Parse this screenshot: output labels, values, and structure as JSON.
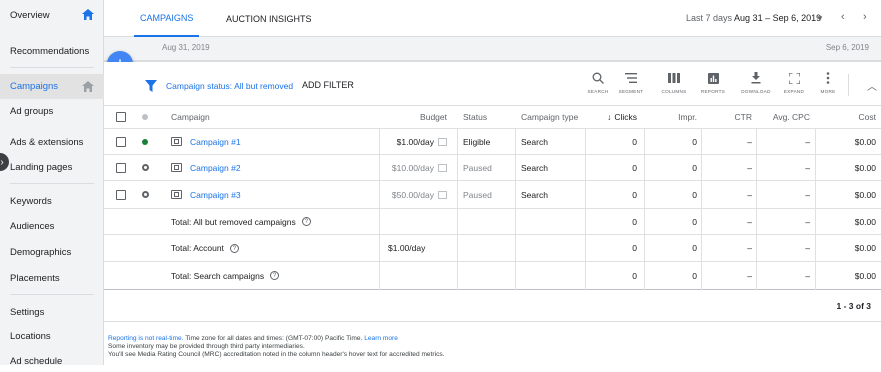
{
  "sidebar": {
    "items": [
      {
        "label": "Overview"
      },
      {
        "label": "Recommendations"
      },
      {
        "label": "Campaigns"
      },
      {
        "label": "Ad groups"
      },
      {
        "label": "Ads & extensions"
      },
      {
        "label": "Landing pages"
      },
      {
        "label": "Keywords"
      },
      {
        "label": "Audiences"
      },
      {
        "label": "Demographics"
      },
      {
        "label": "Placements"
      },
      {
        "label": "Settings"
      },
      {
        "label": "Locations"
      },
      {
        "label": "Ad schedule"
      }
    ]
  },
  "tabs": [
    {
      "label": "CAMPAIGNS"
    },
    {
      "label": "AUCTION INSIGHTS"
    }
  ],
  "date_range": {
    "prefix": "Last 7 days",
    "value": "Aug 31 – Sep 6, 2019"
  },
  "timeline": {
    "start": "Aug 31, 2019",
    "end": "Sep 6, 2019"
  },
  "filter": {
    "label": "Campaign status:",
    "value": "All but removed",
    "add": "ADD FILTER"
  },
  "toolbar": {
    "search": "SEARCH",
    "segment": "SEGMENT",
    "columns": "COLUMNS",
    "reports": "REPORTS",
    "download": "DOWNLOAD",
    "expand": "EXPAND",
    "more": "MORE"
  },
  "table": {
    "headers": {
      "campaign": "Campaign",
      "budget": "Budget",
      "status": "Status",
      "type": "Campaign type",
      "clicks": "Clicks",
      "impr": "Impr.",
      "ctr": "CTR",
      "cpc": "Avg. CPC",
      "cost": "Cost"
    },
    "rows": [
      {
        "name": "Campaign #1",
        "budget": "$1.00/day",
        "status": "Eligible",
        "type": "Search",
        "clicks": "0",
        "impr": "0",
        "ctr": "–",
        "cpc": "–",
        "cost": "$0.00"
      },
      {
        "name": "Campaign #2",
        "budget": "$10.00/day",
        "status": "Paused",
        "type": "Search",
        "clicks": "0",
        "impr": "0",
        "ctr": "–",
        "cpc": "–",
        "cost": "$0.00"
      },
      {
        "name": "Campaign #3",
        "budget": "$50.00/day",
        "status": "Paused",
        "type": "Search",
        "clicks": "0",
        "impr": "0",
        "ctr": "–",
        "cpc": "–",
        "cost": "$0.00"
      }
    ],
    "totals": [
      {
        "label": "Total: All but removed campaigns",
        "budget": "",
        "clicks": "0",
        "impr": "0",
        "ctr": "–",
        "cpc": "–",
        "cost": "$0.00"
      },
      {
        "label": "Total: Account",
        "budget": "$1.00/day",
        "clicks": "0",
        "impr": "0",
        "ctr": "–",
        "cpc": "–",
        "cost": "$0.00"
      },
      {
        "label": "Total: Search campaigns",
        "budget": "",
        "clicks": "0",
        "impr": "0",
        "ctr": "–",
        "cpc": "–",
        "cost": "$0.00"
      }
    ],
    "pager": "1 - 3 of 3"
  },
  "footer": {
    "line1_link": "Reporting is not real-time.",
    "line1_text": " Time zone for all dates and times: (GMT-07:00) Pacific Time.",
    "line1_learn": "Learn more",
    "line2": "Some inventory may be provided through third party intermediaries.",
    "line3": "You'll see Media Rating Council (MRC) accreditation noted in the column header's hover text for accredited metrics."
  },
  "colors": {
    "accent": "#1a73e8",
    "fab": "#4285f4",
    "eligible": "#188038"
  }
}
